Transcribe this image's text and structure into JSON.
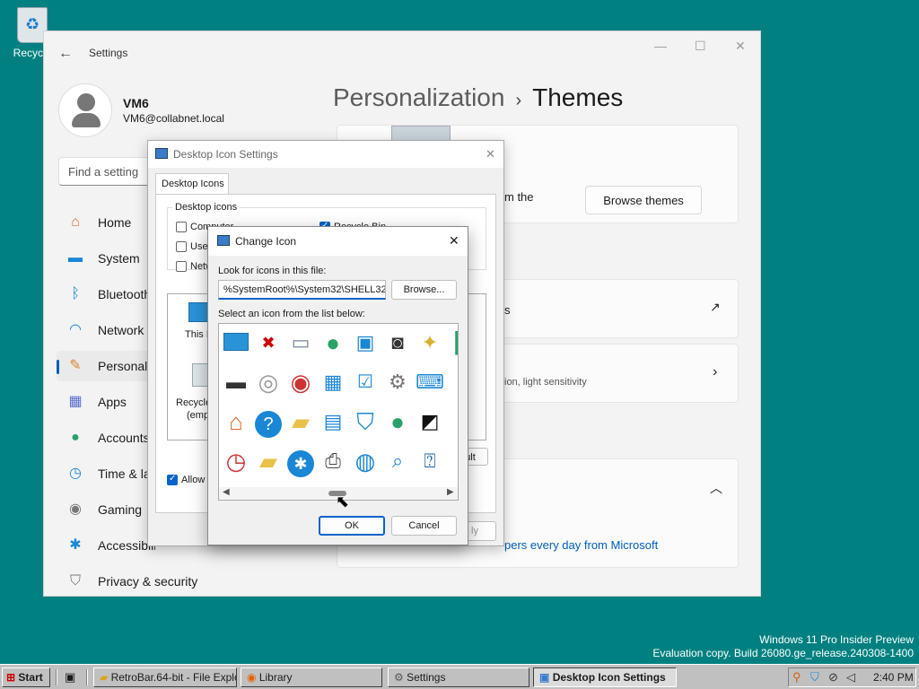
{
  "desktop": {
    "recycle_label": "Recycle",
    "watermark_line1": "Windows 11 Pro Insider Preview",
    "watermark_line2": "Evaluation copy. Build 26080.ge_release.240308-1400"
  },
  "settings": {
    "title": "Settings",
    "user": {
      "name": "VM6",
      "email": "VM6@collabnet.local"
    },
    "search_placeholder": "Find a setting",
    "nav": [
      {
        "label": "Home",
        "icon": "home-icon"
      },
      {
        "label": "System",
        "icon": "monitor-icon"
      },
      {
        "label": "Bluetooth",
        "icon": "bluetooth-icon"
      },
      {
        "label": "Network",
        "icon": "wifi-icon"
      },
      {
        "label": "Personali",
        "icon": "brush-icon",
        "selected": true
      },
      {
        "label": "Apps",
        "icon": "apps-icon"
      },
      {
        "label": "Accounts",
        "icon": "person-icon"
      },
      {
        "label": "Time & la",
        "icon": "clock-icon"
      },
      {
        "label": "Gaming",
        "icon": "gamepad-icon"
      },
      {
        "label": "Accessibility",
        "icon": "accessibility-icon"
      },
      {
        "label": "Privacy & security",
        "icon": "shield-icon"
      }
    ],
    "breadcrumb": {
      "parent": "Personalization",
      "separator": "›",
      "current": "Themes"
    },
    "content": {
      "theme_text": "m the",
      "browse_themes": "Browse themes",
      "row2_text": "s",
      "row3_text": "ion, light sensitivity",
      "spotlight_text": "pers every day from Microsoft"
    }
  },
  "desktop_icon_settings": {
    "title": "Desktop Icon Settings",
    "tab": "Desktop Icons",
    "group_label": "Desktop icons",
    "checkboxes": [
      {
        "label": "Computer",
        "checked": false
      },
      {
        "label": "User",
        "checked": false
      },
      {
        "label": "Netw",
        "checked": false
      },
      {
        "label": "Recycle Bin",
        "checked": true
      }
    ],
    "preview_labels": [
      "This P",
      "Recycle",
      "(empt"
    ],
    "default_button": "ult",
    "allow_label": "Allow t",
    "apply_button": "ly"
  },
  "change_icon": {
    "title": "Change Icon",
    "look_label": "Look for icons in this file:",
    "file_value": "%SystemRoot%\\System32\\SHELL32",
    "browse": "Browse...",
    "select_label": "Select an icon from the list below:",
    "ok": "OK",
    "cancel": "Cancel"
  },
  "taskbar": {
    "start": "Start",
    "tasks": [
      "RetroBar.64-bit - File Explo...",
      "Library",
      "Settings",
      "Desktop Icon Settings"
    ],
    "clock": "2:40 PM"
  },
  "colors": {
    "accent": "#005fb8",
    "desktop": "#008080",
    "taskbar": "#c0c0c0"
  }
}
